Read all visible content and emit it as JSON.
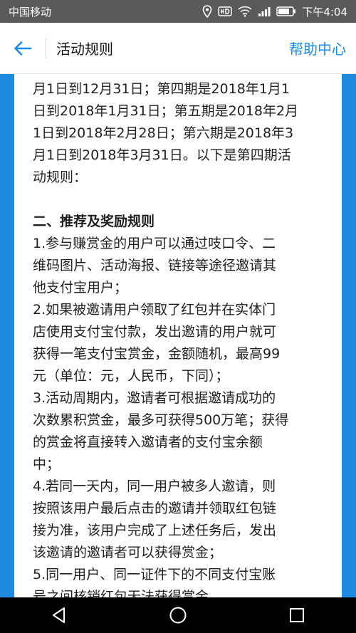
{
  "status_bar": {
    "carrier": "中国移动",
    "time": "下午4:04",
    "icons": [
      "location-icon",
      "hd-icon",
      "wifi-icon",
      "signal-icon",
      "battery-icon"
    ]
  },
  "app_bar": {
    "title": "活动规则",
    "help_label": "帮助中心",
    "icons": [
      "back-arrow-icon"
    ]
  },
  "content": {
    "intro_lines": [
      "月1日到12月31日；第四期是2018年1月1",
      "日到2018年1月31日；第五期是2018年2月",
      "1日到2018年2月28日；第六期是2018年3",
      "月1日到2018年3月31日。以下是第四期活",
      "动规则："
    ],
    "section_title": "二、推荐及奖励规则",
    "rule_lines": [
      "1.参与赚赏金的用户可以通过吱口令、二",
      "维码图片、活动海报、链接等途径邀请其",
      "他支付宝用户；",
      "2.如果被邀请用户领取了红包并在实体门",
      "店使用支付宝付款，发出邀请的用户就可",
      "获得一笔支付宝赏金，金额随机，最高99",
      "元（单位：元，人民币，下同）；",
      "3.活动周期内，邀请者可根据邀请成功的",
      "次数累积赏金，最多可获得500万笔；获得",
      "的赏金将直接转入邀请者的支付宝余额",
      "中；",
      "4.若同一天内，同一用户被多人邀请，则",
      "按照该用户最后点击的邀请并领取红包链",
      "接为准，该用户完成了上述任务后，发出",
      "该邀请的邀请者可以获得赏金；",
      "5.同一用户、同一证件下的不同支付宝账",
      "号之间核销红包无法获得赏金。"
    ]
  },
  "nav_bar": {
    "icons": [
      "back-triangle-icon",
      "home-circle-icon",
      "recents-square-icon"
    ]
  },
  "colors": {
    "accent": "#1a8be8",
    "background_blue": "#1f8be0",
    "status_bar": "#5a5a5a"
  }
}
